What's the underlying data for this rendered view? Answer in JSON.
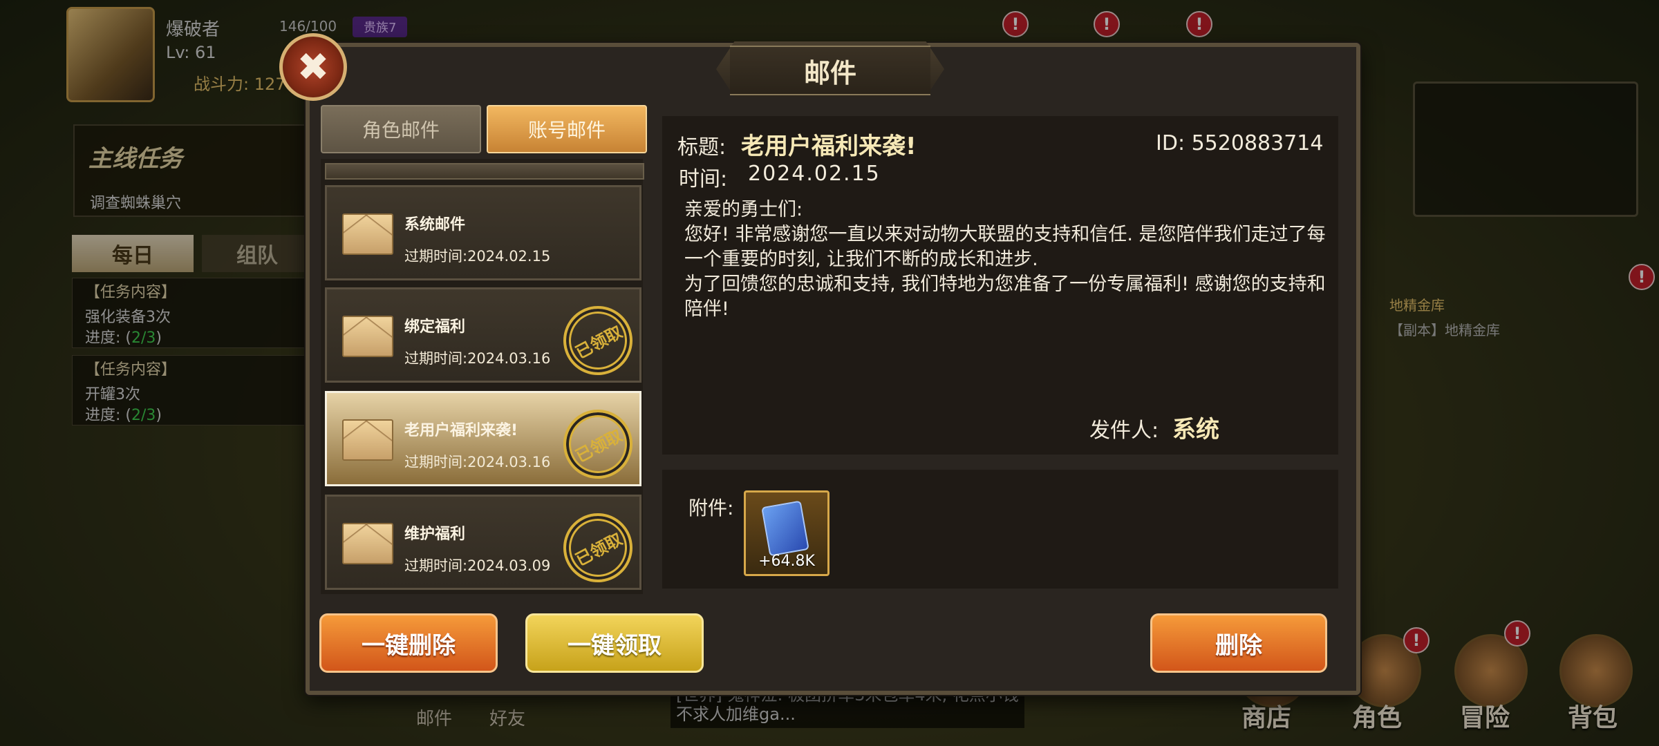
{
  "hud": {
    "player_name": "爆破者",
    "stamina": "146/100",
    "vip": "贵族7",
    "level": "Lv: 61",
    "power": "战斗力: 127",
    "main_quest_title": "主线任务",
    "main_quest_desc": "调查蜘蛛巢穴",
    "tab_daily": "每日",
    "tab_team": "组队",
    "tasks": [
      {
        "head": "【任务内容】",
        "line": "强化装备3次",
        "progress_label": "进度: (",
        "progress": "2/3",
        "progress_end": ")"
      },
      {
        "head": "【任务内容】",
        "line": "开罐3次",
        "progress_label": "进度: (",
        "progress": "2/3",
        "progress_end": ")"
      }
    ],
    "dungeon_title": "地精金库",
    "dungeon_sub": "【副本】地精金库",
    "chat_text": "[世界] 鬼神泣: 极团拼车3米包车4米, 花点小钱不求人加维ga...",
    "bottom_left": [
      "邮件",
      "好友"
    ],
    "bottom_nav": [
      "商店",
      "角色",
      "冒险",
      "背包"
    ],
    "badge": "!"
  },
  "dialog": {
    "title": "邮件",
    "close": "✖",
    "tabs": {
      "role": "角色邮件",
      "account": "账号邮件"
    },
    "mails": [
      {
        "name": "系统邮件",
        "expire": "过期时间:2024.02.15",
        "claimed": false
      },
      {
        "name": "绑定福利",
        "expire": "过期时间:2024.03.16",
        "claimed": true
      },
      {
        "name": "老用户福利来袭!",
        "expire": "过期时间:2024.03.16",
        "claimed": true
      },
      {
        "name": "维护福利",
        "expire": "过期时间:2024.03.09",
        "claimed": true
      }
    ],
    "stamp_text": "已领取",
    "detail": {
      "title_label": "标题:",
      "title": "老用户福利来袭!",
      "id": "ID: 5520883714",
      "time_label": "时间:",
      "time": "2024.02.15",
      "body": [
        "亲爱的勇士们:",
        "您好! 非常感谢您一直以来对动物大联盟的支持和信任. 是您陪伴我们走过了每一个重要的时刻, 让我们不断的成长和进步.",
        "为了回馈您的忠诚和支持, 我们特地为您准备了一份专属福利! 感谢您的支持和陪伴!"
      ],
      "sender_label": "发件人:",
      "sender": "系统",
      "attach_label": "附件:",
      "attach_amount": "+64.8K"
    },
    "buttons": {
      "delete_all": "一键删除",
      "claim_all": "一键领取",
      "delete": "删除"
    }
  },
  "colors": {
    "accent": "#f2b760",
    "title_gold": "#f6e8b6",
    "progress_green": "#3fcf4f",
    "stamp": "#d9b13a"
  }
}
